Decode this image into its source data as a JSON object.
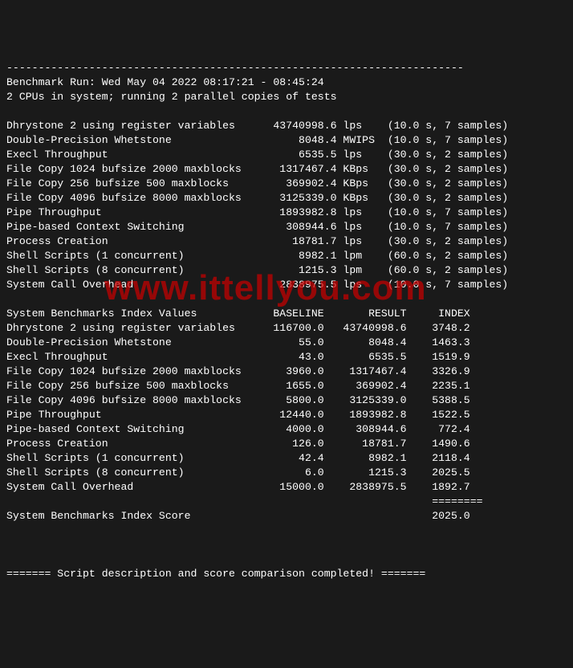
{
  "watermark": "www.ittellyou.com",
  "divider_top": "------------------------------------------------------------------------",
  "run_header": "Benchmark Run: Wed May 04 2022 08:17:21 - 08:45:24",
  "cpu_line": "2 CPUs in system; running 2 parallel copies of tests",
  "raw_tests": [
    {
      "name": "Dhrystone 2 using register variables",
      "value": "43740998.6",
      "unit": "lps",
      "time": "10.0",
      "samples": "7"
    },
    {
      "name": "Double-Precision Whetstone",
      "value": "8048.4",
      "unit": "MWIPS",
      "time": "10.0",
      "samples": "7"
    },
    {
      "name": "Execl Throughput",
      "value": "6535.5",
      "unit": "lps",
      "time": "30.0",
      "samples": "2"
    },
    {
      "name": "File Copy 1024 bufsize 2000 maxblocks",
      "value": "1317467.4",
      "unit": "KBps",
      "time": "30.0",
      "samples": "2"
    },
    {
      "name": "File Copy 256 bufsize 500 maxblocks",
      "value": "369902.4",
      "unit": "KBps",
      "time": "30.0",
      "samples": "2"
    },
    {
      "name": "File Copy 4096 bufsize 8000 maxblocks",
      "value": "3125339.0",
      "unit": "KBps",
      "time": "30.0",
      "samples": "2"
    },
    {
      "name": "Pipe Throughput",
      "value": "1893982.8",
      "unit": "lps",
      "time": "10.0",
      "samples": "7"
    },
    {
      "name": "Pipe-based Context Switching",
      "value": "308944.6",
      "unit": "lps",
      "time": "10.0",
      "samples": "7"
    },
    {
      "name": "Process Creation",
      "value": "18781.7",
      "unit": "lps",
      "time": "30.0",
      "samples": "2"
    },
    {
      "name": "Shell Scripts (1 concurrent)",
      "value": "8982.1",
      "unit": "lpm",
      "time": "60.0",
      "samples": "2"
    },
    {
      "name": "Shell Scripts (8 concurrent)",
      "value": "1215.3",
      "unit": "lpm",
      "time": "60.0",
      "samples": "2"
    },
    {
      "name": "System Call Overhead",
      "value": "2838975.5",
      "unit": "lps",
      "time": "10.0",
      "samples": "7"
    }
  ],
  "index_header": {
    "c1": "System Benchmarks Index Values",
    "c2": "BASELINE",
    "c3": "RESULT",
    "c4": "INDEX"
  },
  "index_rows": [
    {
      "name": "Dhrystone 2 using register variables",
      "baseline": "116700.0",
      "result": "43740998.6",
      "index": "3748.2"
    },
    {
      "name": "Double-Precision Whetstone",
      "baseline": "55.0",
      "result": "8048.4",
      "index": "1463.3"
    },
    {
      "name": "Execl Throughput",
      "baseline": "43.0",
      "result": "6535.5",
      "index": "1519.9"
    },
    {
      "name": "File Copy 1024 bufsize 2000 maxblocks",
      "baseline": "3960.0",
      "result": "1317467.4",
      "index": "3326.9"
    },
    {
      "name": "File Copy 256 bufsize 500 maxblocks",
      "baseline": "1655.0",
      "result": "369902.4",
      "index": "2235.1"
    },
    {
      "name": "File Copy 4096 bufsize 8000 maxblocks",
      "baseline": "5800.0",
      "result": "3125339.0",
      "index": "5388.5"
    },
    {
      "name": "Pipe Throughput",
      "baseline": "12440.0",
      "result": "1893982.8",
      "index": "1522.5"
    },
    {
      "name": "Pipe-based Context Switching",
      "baseline": "4000.0",
      "result": "308944.6",
      "index": "772.4"
    },
    {
      "name": "Process Creation",
      "baseline": "126.0",
      "result": "18781.7",
      "index": "1490.6"
    },
    {
      "name": "Shell Scripts (1 concurrent)",
      "baseline": "42.4",
      "result": "8982.1",
      "index": "2118.4"
    },
    {
      "name": "Shell Scripts (8 concurrent)",
      "baseline": "6.0",
      "result": "1215.3",
      "index": "2025.5"
    },
    {
      "name": "System Call Overhead",
      "baseline": "15000.0",
      "result": "2838975.5",
      "index": "1892.7"
    }
  ],
  "score_sep": "                                                                   ========",
  "score_line": {
    "label": "System Benchmarks Index Score",
    "value": "2025.0"
  },
  "footer": "======= Script description and score comparison completed! ======="
}
